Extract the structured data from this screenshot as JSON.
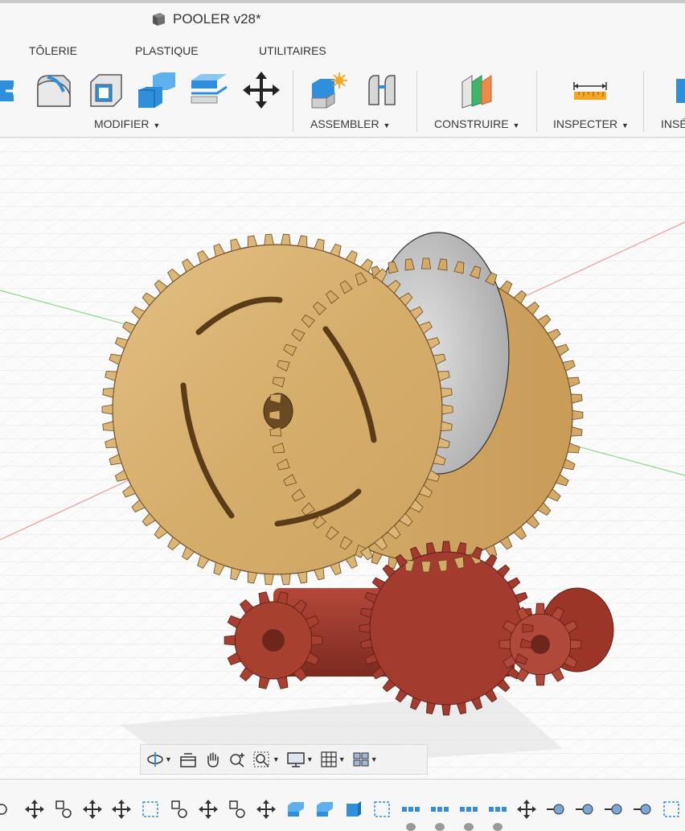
{
  "document": {
    "title": "POOLER v28*"
  },
  "tabs": [
    {
      "label": "TÔLERIE"
    },
    {
      "label": "PLASTIQUE"
    },
    {
      "label": "UTILITAIRES"
    }
  ],
  "ribbon": {
    "groups": [
      {
        "label": "MODIFIER"
      },
      {
        "label": "ASSEMBLER"
      },
      {
        "label": "CONSTRUIRE"
      },
      {
        "label": "INSPECTER"
      },
      {
        "label": "INSÉ"
      }
    ],
    "caret": "▼"
  },
  "colors": {
    "wood": "#d9b57a",
    "gear_red": "#9b3528",
    "accent_blue": "#2f8fdc",
    "axis_red": "#e79a9a",
    "axis_green": "#8fd68f"
  },
  "navbar": {
    "tools": [
      "orbit-icon",
      "look-at-icon",
      "pan-icon",
      "zoom-icon",
      "fit-icon",
      "display-settings-icon",
      "grid-settings-icon",
      "viewports-icon"
    ]
  },
  "timeline": {
    "items": [
      "joint-icon",
      "move-icon",
      "rigid-group-icon",
      "move-icon",
      "move-icon",
      "sketch-icon",
      "rigid-group-icon",
      "move-icon",
      "rigid-group-icon",
      "move-icon",
      "extrude-icon",
      "extrude-icon",
      "box-icon",
      "sketch-icon",
      "pattern-icon",
      "pattern-icon",
      "pattern-icon",
      "pattern-icon",
      "move-icon",
      "component-icon",
      "component-icon",
      "component-icon",
      "component-icon",
      "sketch-icon",
      "move-icon"
    ]
  }
}
